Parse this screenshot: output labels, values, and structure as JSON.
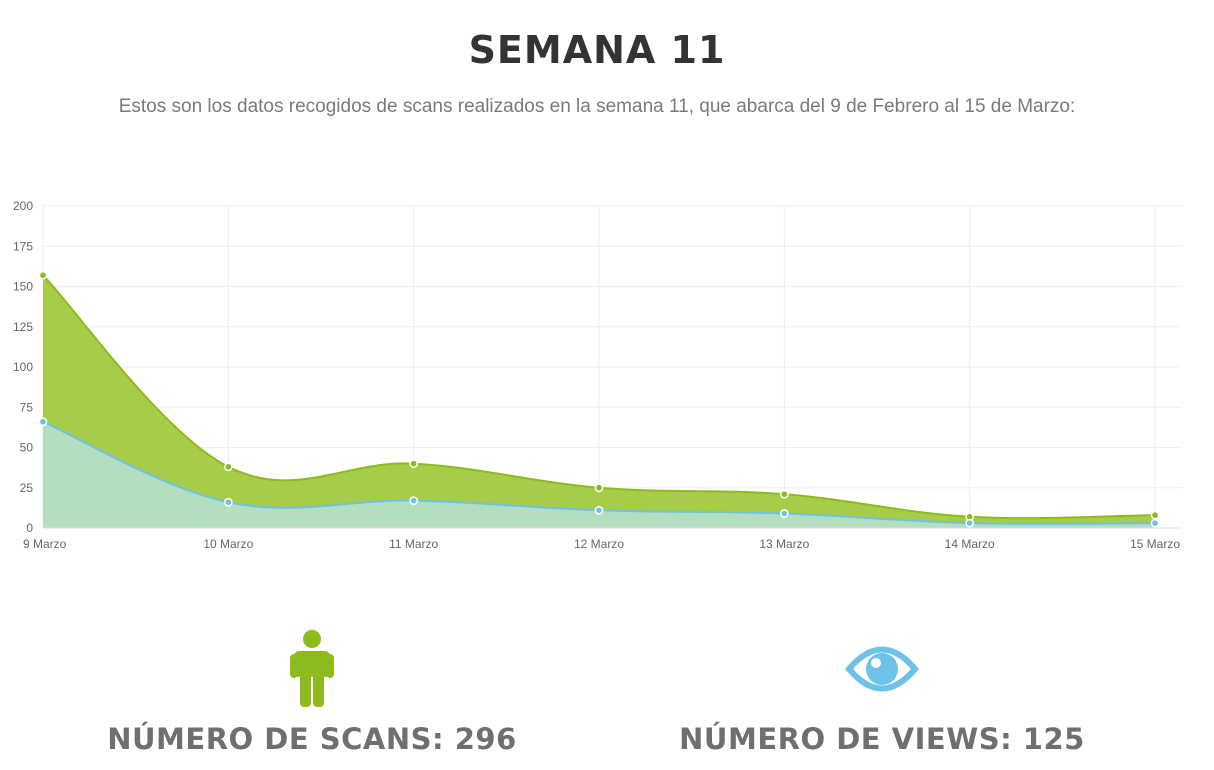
{
  "header": {
    "title": "SEMANA 11",
    "subtitle": "Estos son los datos recogidos de scans realizados en la semana 11, que abarca del 9 de Febrero al 15 de Marzo:"
  },
  "chart_data": {
    "type": "area",
    "categories": [
      "9 Marzo",
      "10 Marzo",
      "11 Marzo",
      "12 Marzo",
      "13 Marzo",
      "14 Marzo",
      "15 Marzo"
    ],
    "ylim": [
      0,
      200
    ],
    "yticks": [
      0,
      25,
      50,
      75,
      100,
      125,
      150,
      175,
      200
    ],
    "grid": true,
    "series": [
      {
        "key": "scans",
        "values": [
          157,
          38,
          40,
          25,
          21,
          7,
          8
        ],
        "line_color": "#8dbb1e",
        "fill_color": "#a6cc4a"
      },
      {
        "key": "views",
        "values": [
          66,
          16,
          17,
          11,
          9,
          3,
          3
        ],
        "line_color": "#6ec1e8",
        "fill_color": "#b3dfc0"
      }
    ]
  },
  "stats": {
    "scans": {
      "icon": "person-icon",
      "label": "NÚMERO DE SCANS: 296",
      "color": "#8dbb1e"
    },
    "views": {
      "icon": "eye-icon",
      "label": "NÚMERO DE VIEWS: 125",
      "color": "#6ec1e8"
    }
  }
}
